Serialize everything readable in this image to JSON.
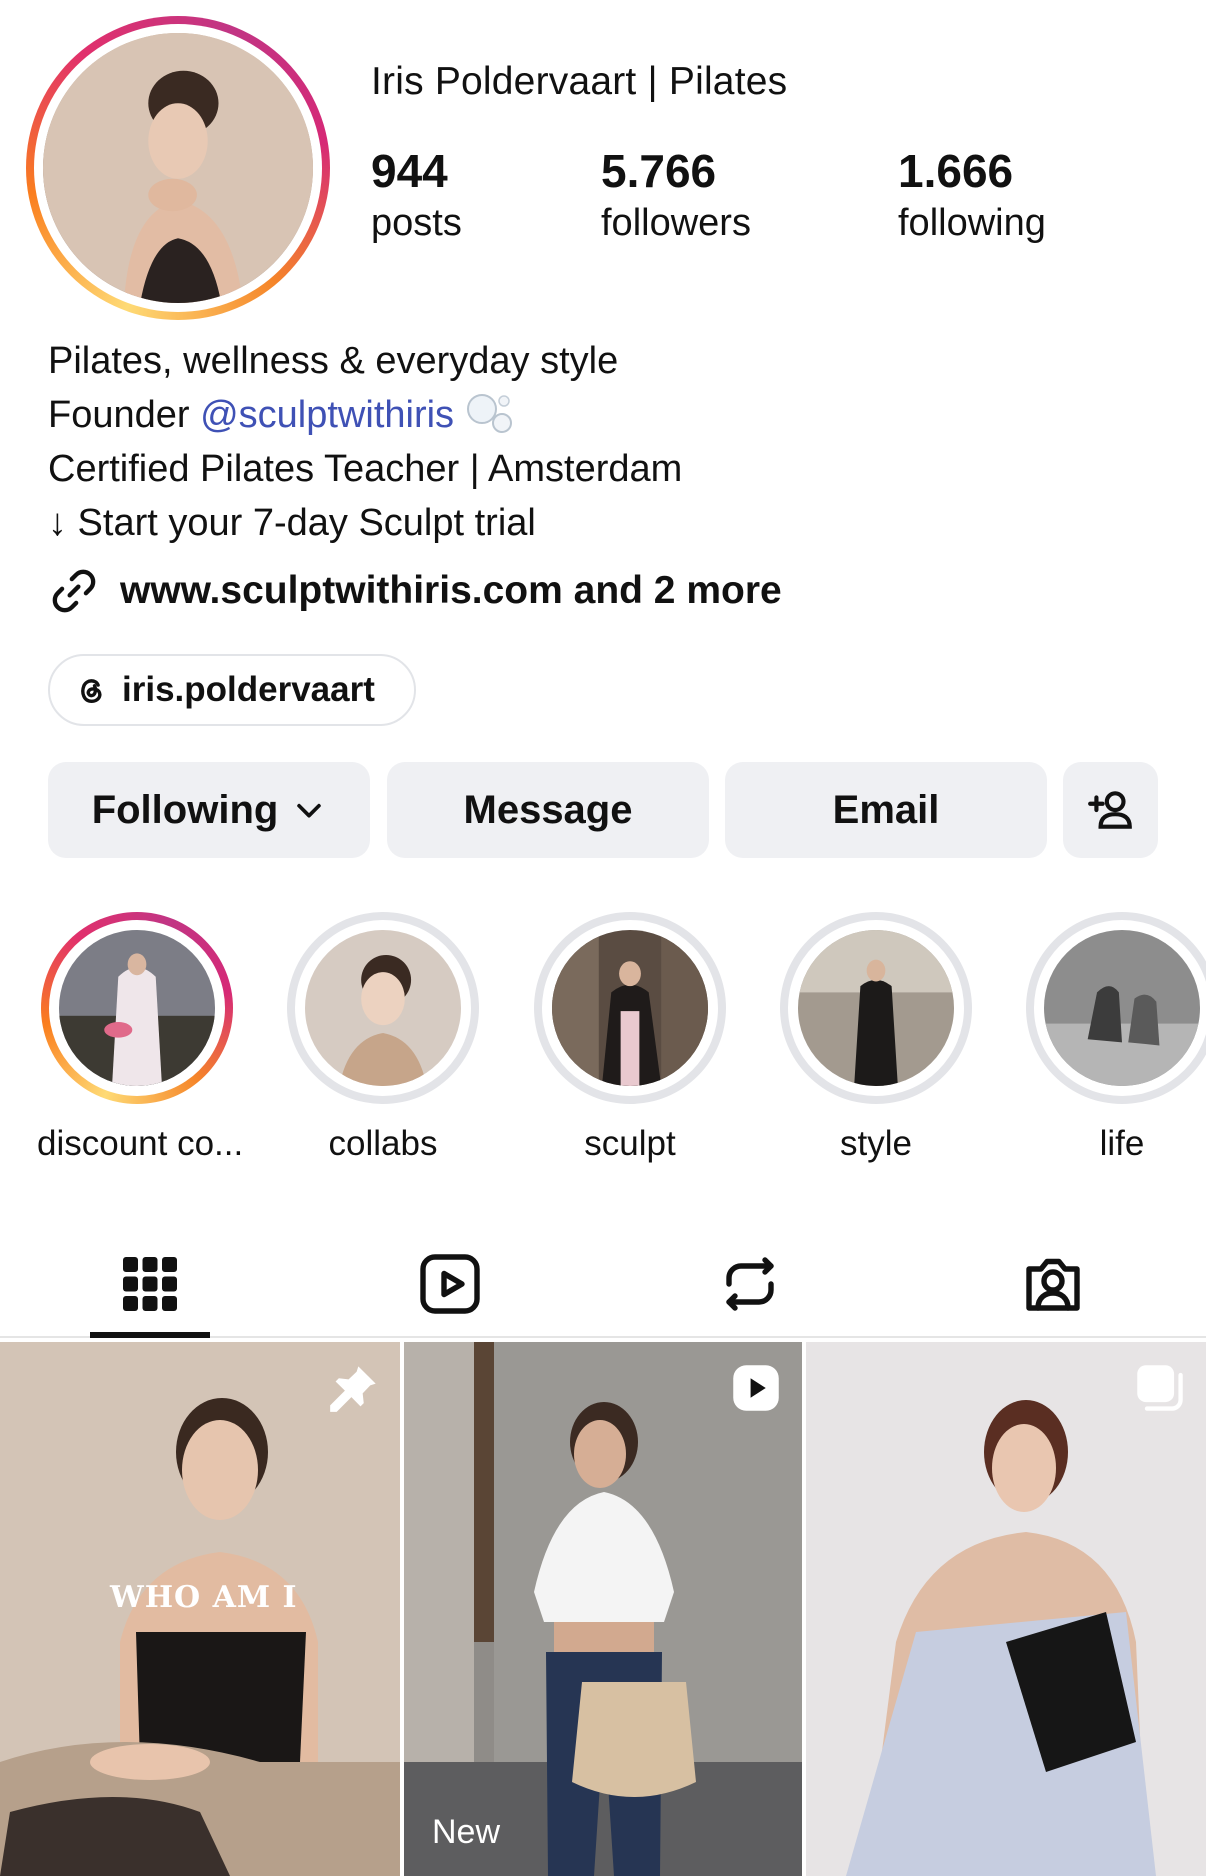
{
  "profile": {
    "name": "Iris Poldervaart | Pilates",
    "stats": [
      {
        "value": "944",
        "label": "posts"
      },
      {
        "value": "5.766",
        "label": "followers"
      },
      {
        "value": "1.666",
        "label": "following"
      }
    ]
  },
  "bio": {
    "line1": "Pilates, wellness & everyday style",
    "line2_prefix": "Founder ",
    "line2_mention": "@sculptwithiris",
    "line3": "Certified Pilates Teacher | Amsterdam",
    "line4": "↓ Start your 7-day Sculpt trial"
  },
  "link": {
    "text": "www.sculptwithiris.com and 2 more",
    "icon": "link-icon"
  },
  "threads": {
    "handle": "iris.poldervaart",
    "icon": "threads-icon"
  },
  "actions": {
    "following": "Following",
    "message": "Message",
    "email": "Email",
    "add_user_icon": "add-user-icon"
  },
  "highlights": [
    {
      "label": "discount co...",
      "ring": "colored"
    },
    {
      "label": "collabs",
      "ring": "seen"
    },
    {
      "label": "sculpt",
      "ring": "seen"
    },
    {
      "label": "style",
      "ring": "seen"
    },
    {
      "label": "life",
      "ring": "seen"
    }
  ],
  "tabs": [
    {
      "name": "grid",
      "icon": "grid-icon",
      "active": true
    },
    {
      "name": "reels",
      "icon": "reels-icon",
      "active": false
    },
    {
      "name": "reposts",
      "icon": "repost-icon",
      "active": false
    },
    {
      "name": "tagged",
      "icon": "tagged-icon",
      "active": false
    }
  ],
  "posts": [
    {
      "caption": "WHO AM I",
      "corner_icon": "pin-icon"
    },
    {
      "badge": "New",
      "corner_icon": "reel-icon"
    },
    {
      "corner_icon": "carousel-icon"
    }
  ],
  "colors": {
    "mention": "#3f51b5",
    "button_bg": "#eff0f3",
    "accent_ring": "#e1306c"
  }
}
